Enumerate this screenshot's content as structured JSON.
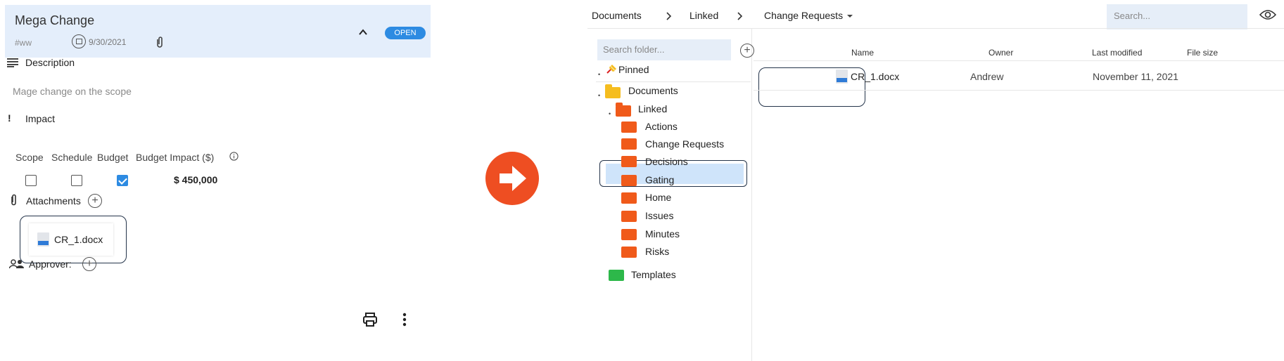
{
  "left": {
    "title": "Mega Change",
    "id": "#ww",
    "date": "9/30/2021",
    "status": "OPEN",
    "description_label": "Description",
    "description_text": "Mage change on the scope",
    "impact_label": "Impact",
    "columns": [
      "Scope",
      "Schedule",
      "Budget",
      "Budget Impact ($)"
    ],
    "checks": {
      "scope": false,
      "schedule": false,
      "budget": true
    },
    "budget_value": "$ 450,000",
    "attachments_label": "Attachments",
    "attachment_file": "CR_1.docx",
    "approver_label": "Approver:",
    "colors": {
      "header_bg": "#e4eefb",
      "badge": "#2d8be2"
    }
  },
  "arrow_color": "#ee4e22",
  "right": {
    "breadcrumb": [
      "Documents",
      "Linked",
      "Change Requests"
    ],
    "search_placeholder": "Search...",
    "folder_search_placeholder": "Search folder...",
    "tree": {
      "pinned": "Pinned",
      "documents": "Documents",
      "linked": "Linked",
      "children": [
        "Actions",
        "Change Requests",
        "Decisions",
        "Gating",
        "Home",
        "Issues",
        "Minutes",
        "Risks"
      ],
      "templates": "Templates"
    },
    "table": {
      "headers": [
        "Name",
        "Owner",
        "Last modified",
        "File size"
      ],
      "rows": [
        {
          "name": "CR_1.docx",
          "owner": "Andrew",
          "modified": "November 11, 2021"
        }
      ]
    }
  }
}
